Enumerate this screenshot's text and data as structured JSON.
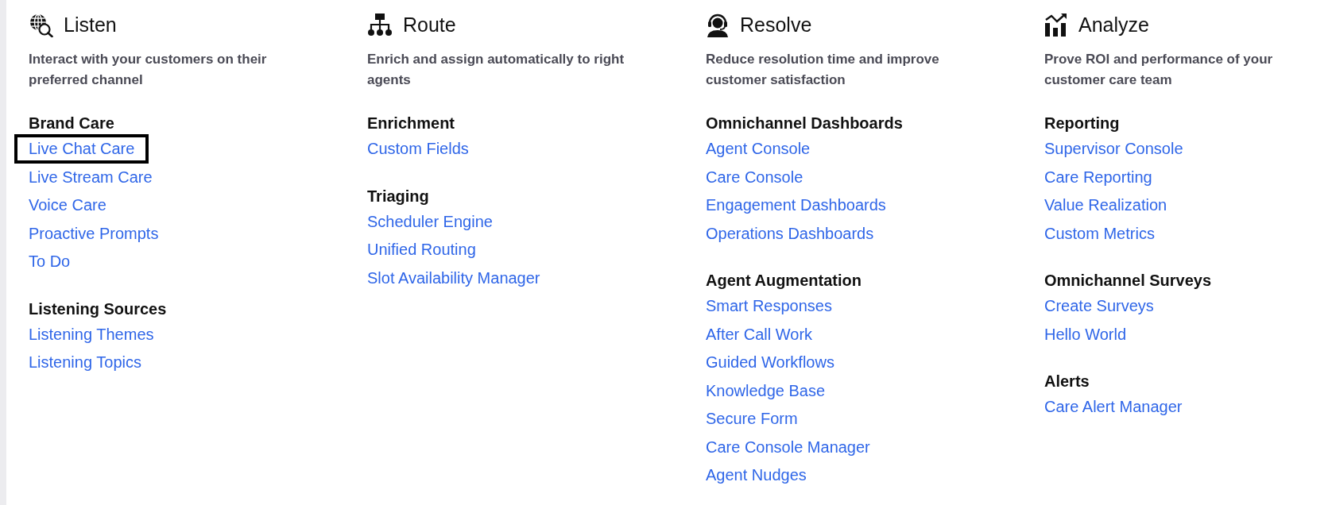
{
  "columns": [
    {
      "kind": "globe-search",
      "title": "Listen",
      "description": "Interact with your customers on their preferred channel",
      "groups": [
        {
          "heading": "Brand Care",
          "links": [
            {
              "label": "Live Chat Care",
              "highlighted": true
            },
            {
              "label": "Live Stream Care",
              "highlighted": false
            },
            {
              "label": "Voice Care",
              "highlighted": false
            },
            {
              "label": "Proactive Prompts",
              "highlighted": false
            },
            {
              "label": "To Do",
              "highlighted": false
            }
          ]
        },
        {
          "heading": "Listening Sources",
          "links": [
            {
              "label": "Listening Themes",
              "highlighted": false
            },
            {
              "label": "Listening Topics",
              "highlighted": false
            }
          ]
        }
      ]
    },
    {
      "kind": "hierarchy",
      "title": "Route",
      "description": "Enrich and assign automatically to right agents",
      "groups": [
        {
          "heading": "Enrichment",
          "links": [
            {
              "label": "Custom Fields",
              "highlighted": false
            }
          ]
        },
        {
          "heading": "Triaging",
          "links": [
            {
              "label": "Scheduler Engine",
              "highlighted": false
            },
            {
              "label": "Unified Routing",
              "highlighted": false
            },
            {
              "label": "Slot Availability Manager",
              "highlighted": false
            }
          ]
        }
      ]
    },
    {
      "kind": "headset",
      "title": "Resolve",
      "description": "Reduce resolution time and improve customer satisfaction",
      "groups": [
        {
          "heading": "Omnichannel Dashboards",
          "links": [
            {
              "label": "Agent Console",
              "highlighted": false
            },
            {
              "label": "Care Console",
              "highlighted": false
            },
            {
              "label": "Engagement Dashboards",
              "highlighted": false
            },
            {
              "label": "Operations Dashboards",
              "highlighted": false
            }
          ]
        },
        {
          "heading": "Agent Augmentation",
          "links": [
            {
              "label": "Smart Responses",
              "highlighted": false
            },
            {
              "label": "After Call Work",
              "highlighted": false
            },
            {
              "label": "Guided Workflows",
              "highlighted": false
            },
            {
              "label": "Knowledge Base",
              "highlighted": false
            },
            {
              "label": "Secure Form",
              "highlighted": false
            },
            {
              "label": "Care Console Manager",
              "highlighted": false
            },
            {
              "label": "Agent Nudges",
              "highlighted": false
            }
          ]
        }
      ]
    },
    {
      "kind": "chart",
      "title": "Analyze",
      "description": "Prove ROI and performance of your customer care team",
      "groups": [
        {
          "heading": "Reporting",
          "links": [
            {
              "label": "Supervisor Console",
              "highlighted": false
            },
            {
              "label": "Care Reporting",
              "highlighted": false
            },
            {
              "label": "Value Realization",
              "highlighted": false
            },
            {
              "label": "Custom Metrics",
              "highlighted": false
            }
          ]
        },
        {
          "heading": "Omnichannel Surveys",
          "links": [
            {
              "label": "Create Surveys",
              "highlighted": false
            },
            {
              "label": "Hello World",
              "highlighted": false
            }
          ]
        },
        {
          "heading": "Alerts",
          "links": [
            {
              "label": "Care Alert Manager",
              "highlighted": false
            }
          ]
        }
      ]
    }
  ]
}
